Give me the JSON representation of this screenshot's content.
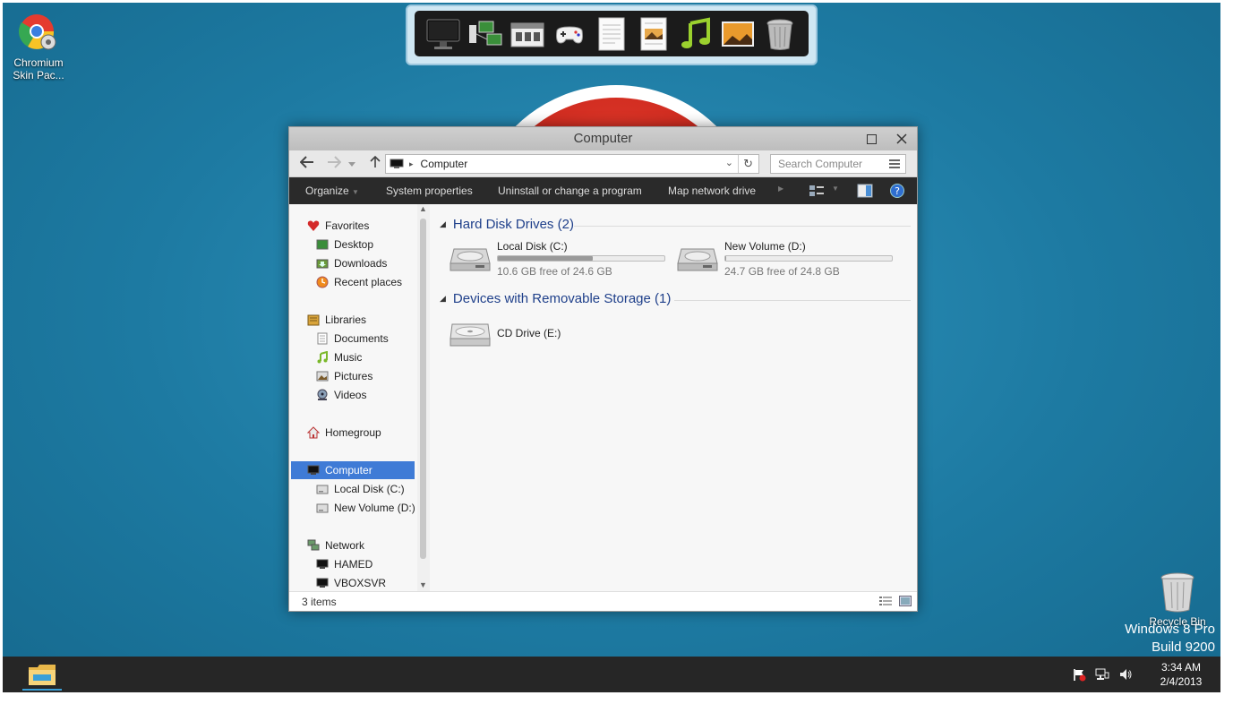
{
  "desktop": {
    "icons": [
      {
        "name": "chromium",
        "label": "Chromium Skin Pac...",
        "icon": "chromium-icon"
      },
      {
        "name": "recycle-bin",
        "label": "Recycle Bin",
        "icon": "recycle-bin-icon"
      }
    ],
    "watermark_line1": "Windows 8 Pro",
    "watermark_line2": "Build 9200",
    "background_color": "#1d7aa2"
  },
  "dock": {
    "items": [
      "monitor-icon",
      "network-computers-icon",
      "control-panel-icon",
      "gamepad-icon",
      "document-icon",
      "picture-document-icon",
      "music-note-icon",
      "landscape-picture-icon",
      "trash-can-icon"
    ]
  },
  "window": {
    "title": "Computer",
    "address": "Computer",
    "search_placeholder": "Search Computer",
    "commands": {
      "organize": "Organize",
      "system_properties": "System properties",
      "uninstall": "Uninstall or change a program",
      "map_drive": "Map network drive"
    },
    "nav": {
      "favorites": "Favorites",
      "desktop": "Desktop",
      "downloads": "Downloads",
      "recent": "Recent places",
      "libraries": "Libraries",
      "documents": "Documents",
      "music": "Music",
      "pictures": "Pictures",
      "videos": "Videos",
      "homegroup": "Homegroup",
      "computer": "Computer",
      "local_disk": "Local Disk (C:)",
      "new_volume": "New Volume (D:)",
      "network": "Network",
      "hamed": "HAMED",
      "vboxsvr": "VBOXSVR"
    },
    "groups": {
      "hard_disks": "Hard Disk Drives (2)",
      "removable": "Devices with Removable Storage (1)"
    },
    "drives": [
      {
        "label": "Local Disk (C:)",
        "free": "10.6 GB free of 24.6 GB",
        "used_fraction": 0.57
      },
      {
        "label": "New Volume (D:)",
        "free": "24.7 GB free of 24.8 GB",
        "used_fraction": 0.004
      }
    ],
    "cd_drive": "CD Drive (E:)",
    "status": "3 items"
  },
  "taskbar": {
    "time": "3:34 AM",
    "date": "2/4/2013",
    "accent": "#3aa0d8"
  }
}
